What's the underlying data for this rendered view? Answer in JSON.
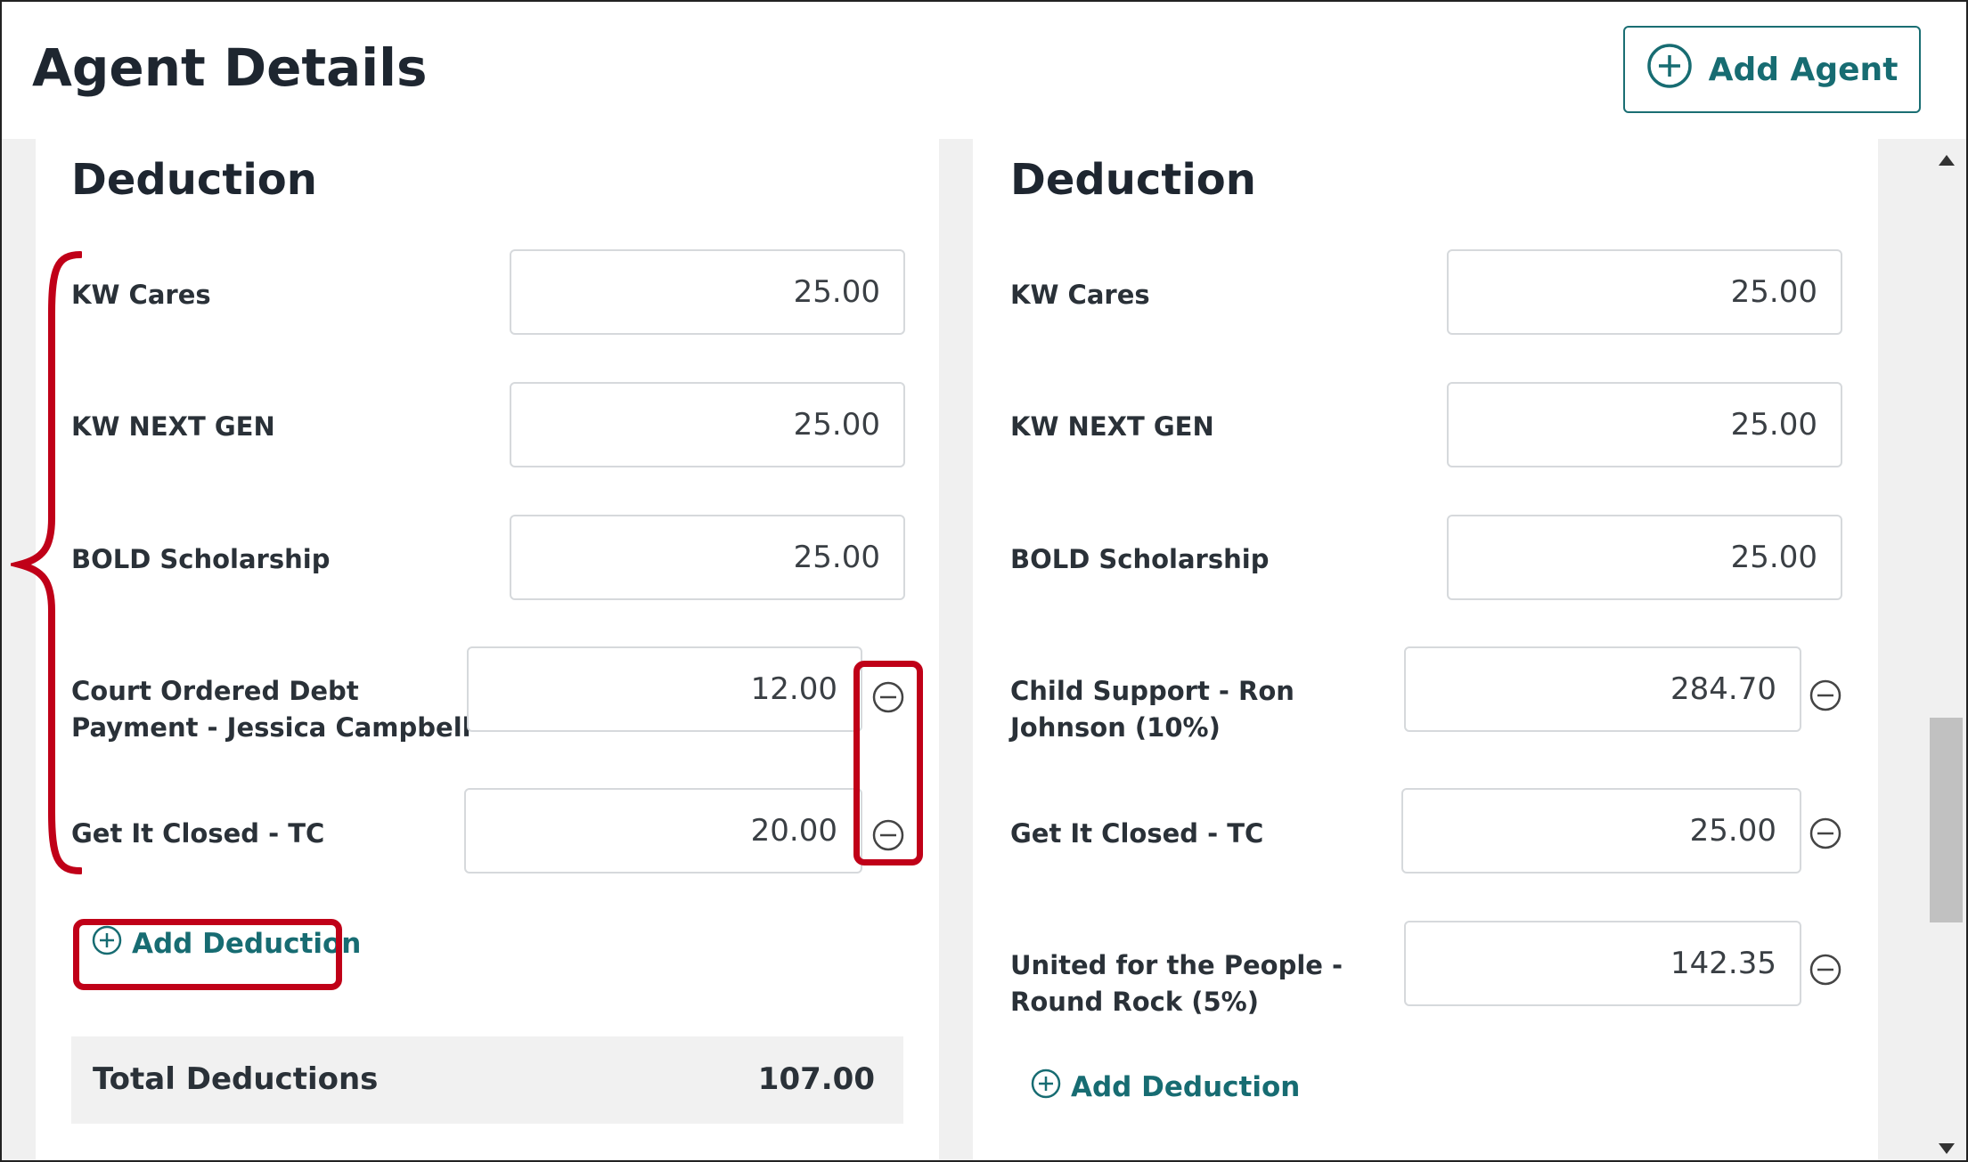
{
  "header": {
    "title": "Agent Details",
    "add_agent_label": "Add Agent"
  },
  "left": {
    "section_title": "Deduction",
    "deductions": [
      {
        "label": "KW Cares",
        "value": "25.00"
      },
      {
        "label": "KW NEXT GEN",
        "value": "25.00"
      },
      {
        "label": "BOLD Scholarship",
        "value": "25.00"
      },
      {
        "label": "Court Ordered Debt Payment - Jessica Campbell",
        "value": "12.00"
      },
      {
        "label": "Get It Closed - TC",
        "value": "20.00"
      }
    ],
    "add_deduction_label": "Add Deduction",
    "total_label": "Total Deductions",
    "total_value": "107.00"
  },
  "right": {
    "section_title": "Deduction",
    "deductions": [
      {
        "label": "KW Cares",
        "value": "25.00"
      },
      {
        "label": "KW NEXT GEN",
        "value": "25.00"
      },
      {
        "label": "BOLD Scholarship",
        "value": "25.00"
      },
      {
        "label": "Child Support - Ron Johnson (10%)",
        "value": "284.70"
      },
      {
        "label": "Get It Closed - TC",
        "value": "25.00"
      },
      {
        "label": "United for the People - Round Rock (5%)",
        "value": "142.35"
      }
    ],
    "add_deduction_label": "Add Deduction"
  },
  "colors": {
    "accent": "#176c72",
    "annotation": "#c00018",
    "panel_bg": "#f0f0f0"
  },
  "icons": {
    "add": "plus-circle-icon",
    "remove": "minus-circle-icon"
  }
}
